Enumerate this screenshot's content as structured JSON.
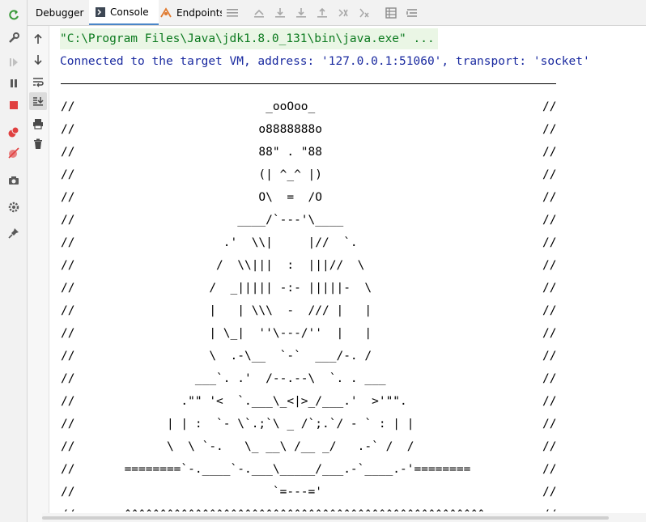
{
  "tabs": [
    {
      "label": "Debugger",
      "icon": "debugger-icon"
    },
    {
      "label": "Console",
      "icon": "console-icon",
      "active": true
    },
    {
      "label": "Endpoints",
      "icon": "endpoints-icon"
    }
  ],
  "toolbar_icons": [
    "menu-icon",
    "show-execution-point-icon",
    "step-over-icon",
    "step-into-icon",
    "step-out-icon",
    "run-to-cursor-icon",
    "evaluate-icon",
    "frames-icon",
    "threads-icon"
  ],
  "left_toolbar_icons": [
    "rerun-icon",
    "settings-icon",
    "resume-icon",
    "pause-icon",
    "stop-icon",
    "view-breakpoints-icon",
    "mute-breakpoints-icon",
    "camera-icon",
    "gear-icon",
    "pin-icon"
  ],
  "console_toolbar_icons": [
    "up-arrow-icon",
    "down-arrow-icon",
    "soft-wrap-icon",
    "scroll-to-end-icon",
    "print-icon",
    "trash-icon"
  ],
  "console": {
    "command_line": "\"C:\\Program Files\\Java\\jdk1.8.0_131\\bin\\java.exe\" ...",
    "connected_line": "Connected to the target VM, address: '127.0.0.1:51060', transport: 'socket'",
    "banner_lines": [
      {
        "left": "//",
        "art": "                             _ooOoo_",
        "right": "//"
      },
      {
        "left": "//",
        "art": "                            o8888888o",
        "right": "//"
      },
      {
        "left": "//",
        "art": "                            88\" . \"88",
        "right": "//"
      },
      {
        "left": "//",
        "art": "                            (| ^_^ |)",
        "right": "//"
      },
      {
        "left": "//",
        "art": "                            O\\  =  /O",
        "right": "//"
      },
      {
        "left": "//",
        "art": "                         ____/`---'\\____",
        "right": "//"
      },
      {
        "left": "//",
        "art": "                       .'  \\\\|     |//  `.",
        "right": "//"
      },
      {
        "left": "//",
        "art": "                      /  \\\\|||  :  |||//  \\",
        "right": "//"
      },
      {
        "left": "//",
        "art": "                     /  _||||| -:- |||||-  \\",
        "right": "//"
      },
      {
        "left": "//",
        "art": "                     |   | \\\\\\  -  /// |   |",
        "right": "//"
      },
      {
        "left": "//",
        "art": "                     | \\_|  ''\\---/''  |   |",
        "right": "//"
      },
      {
        "left": "//",
        "art": "                     \\  .-\\__  `-`  ___/-. /",
        "right": "//"
      },
      {
        "left": "//",
        "art": "                   ___`. .'  /--.--\\  `. . ___",
        "right": "//"
      },
      {
        "left": "//",
        "art": "                 .\"\" '<  `.___\\_<|>_/___.'  >'\"\".",
        "right": "//"
      },
      {
        "left": "//",
        "art": "               | | :  `- \\`.;`\\ _ /`;.`/ - ` : | |",
        "right": "//"
      },
      {
        "left": "//",
        "art": "               \\  \\ `-.   \\_ __\\ /__ _/   .-` /  /",
        "right": "//"
      },
      {
        "left": "//",
        "art": "         ========`-.____`-.___\\_____/___.-`____.-'========",
        "right": "//"
      },
      {
        "left": "//",
        "art": "                              `=---='",
        "right": "//"
      },
      {
        "left": "//",
        "art": "         ^^^^^^^^^^^^^^^^^^^^^^^^^^^^^^^^^^^^^^^^^^^^^^^^^^^",
        "right": "//"
      }
    ]
  }
}
